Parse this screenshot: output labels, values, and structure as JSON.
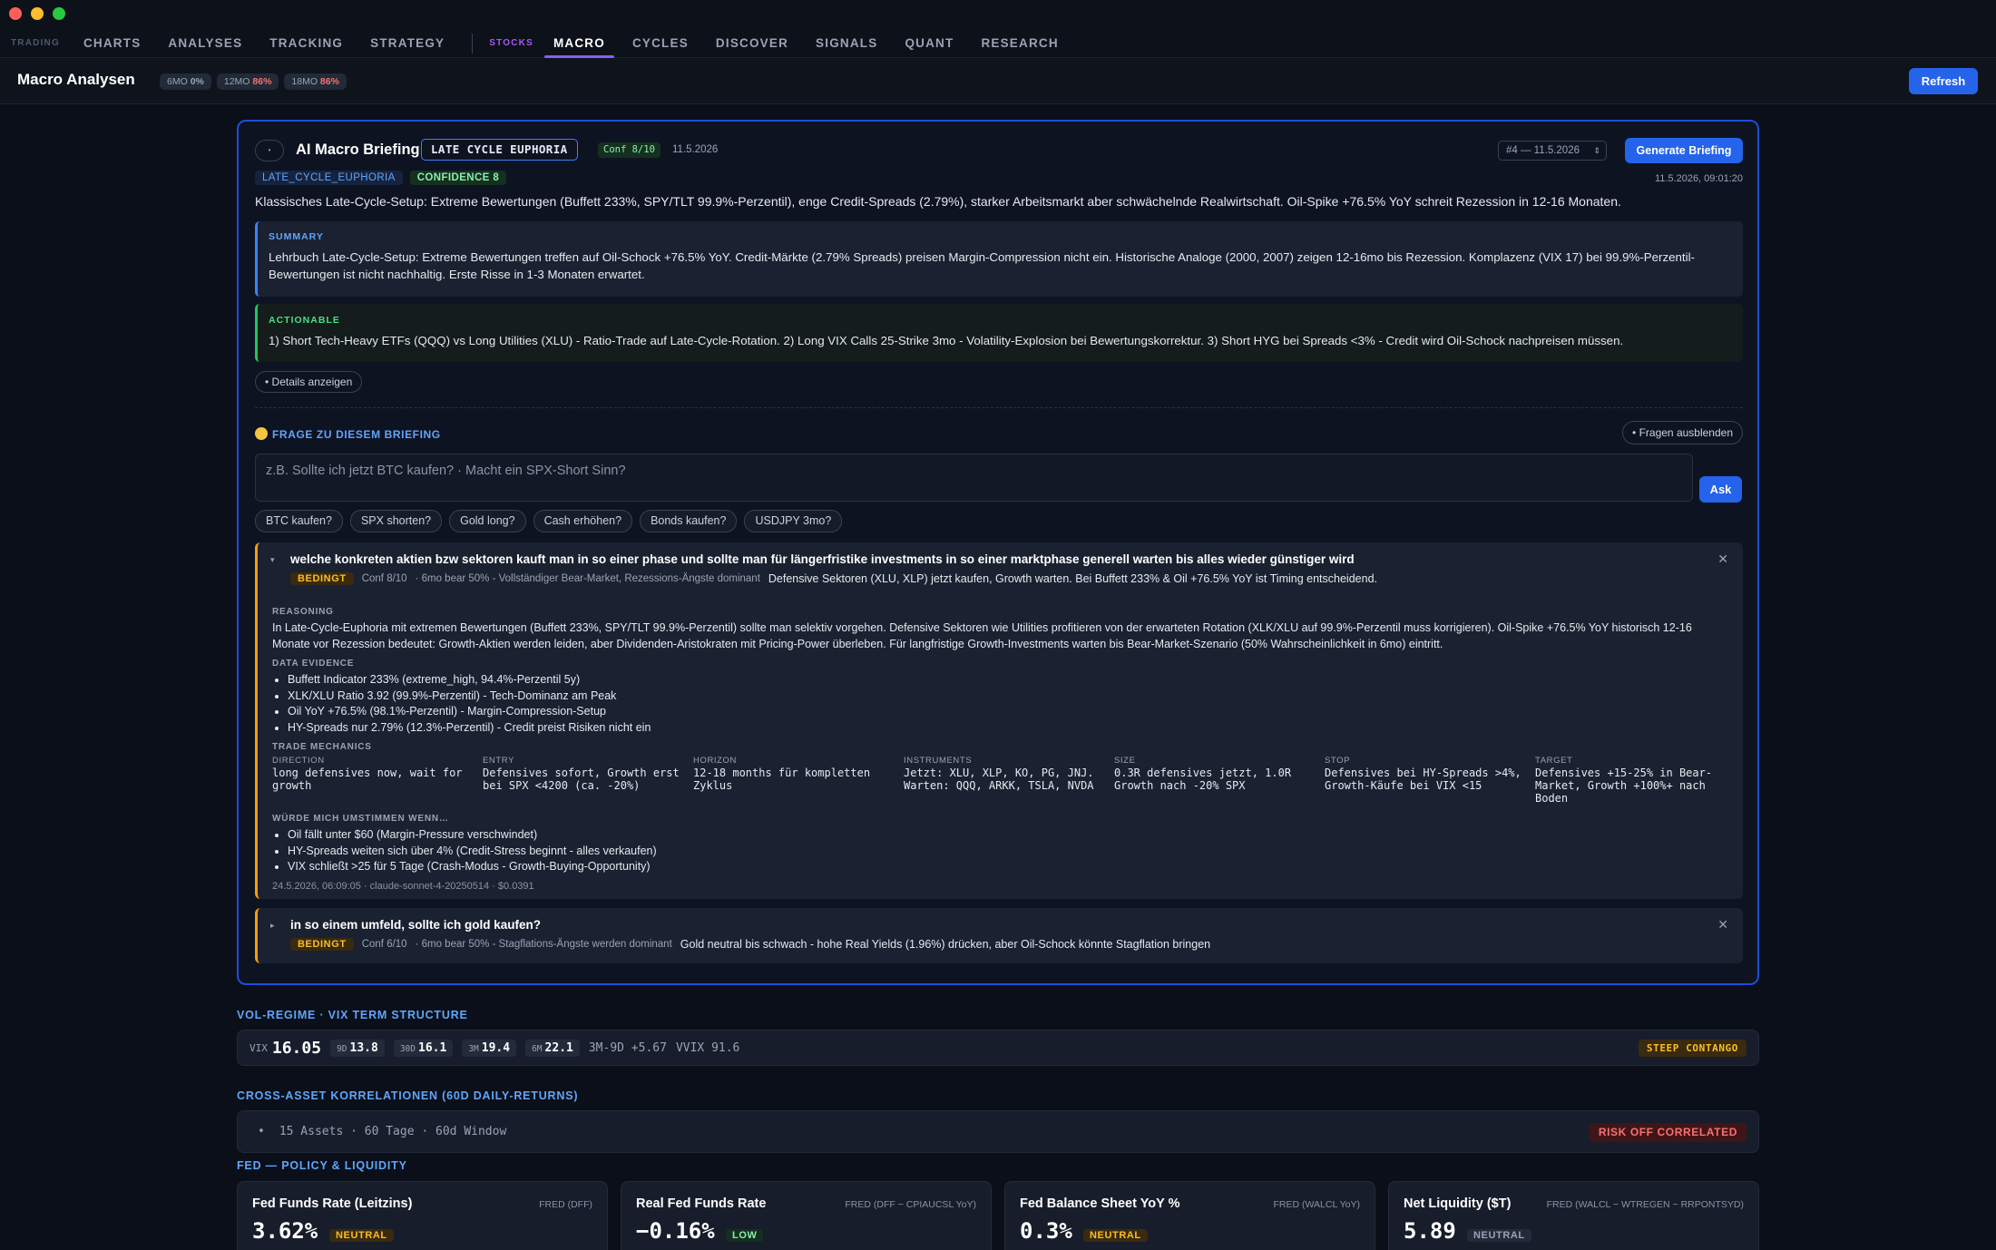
{
  "nav": {
    "trading_group": "TRADING",
    "trading_items": [
      "CHARTS",
      "ANALYSES",
      "TRACKING",
      "STRATEGY"
    ],
    "stocks_group": "STOCKS",
    "stocks_items": [
      "MACRO",
      "CYCLES",
      "DISCOVER",
      "SIGNALS",
      "QUANT",
      "RESEARCH"
    ],
    "active": "MACRO",
    "colors": {
      "trading": "#4b5874",
      "stocks": "#a855f7",
      "active_underline": "#8b5cf6"
    }
  },
  "header": {
    "title": "Macro Analysen",
    "badges": [
      {
        "label": "6MO",
        "value": "0%"
      },
      {
        "label": "12MO",
        "value": "86%"
      },
      {
        "label": "18MO",
        "value": "86%"
      }
    ],
    "refresh_label": "Refresh"
  },
  "briefing": {
    "toggle_icon": "•",
    "title": "AI Macro Briefing",
    "regime": "LATE CYCLE EUPHORIA",
    "conf": "Conf 8/10",
    "date": "11.5.2026",
    "select_value": "#4 — 11.5.2026",
    "generate_label": "Generate Briefing",
    "tag_regime": "LATE_CYCLE_EUPHORIA",
    "tag_conf": "CONFIDENCE 8",
    "timestamp": "11.5.2026, 09:01:20",
    "lead": "Klassisches Late-Cycle-Setup: Extreme Bewertungen (Buffett 233%, SPY/TLT 99.9%-Perzentil), enge Credit-Spreads (2.79%), starker Arbeitsmarkt aber schwächelnde Realwirtschaft. Oil-Spike +76.5% YoY schreit Rezession in 12-16 Monaten.",
    "summary_label": "SUMMARY",
    "summary": "Lehrbuch Late-Cycle-Setup: Extreme Bewertungen treffen auf Oil-Schock +76.5% YoY. Credit-Märkte (2.79% Spreads) preisen Margin-Compression nicht ein. Historische Analoge (2000, 2007) zeigen 12-16mo bis Rezession. Komplazenz (VIX 17) bei 99.9%-Perzentil-Bewertungen ist nicht nachhaltig. Erste Risse in 1-3 Monaten erwartet.",
    "actionable_label": "ACTIONABLE",
    "actionable": "1) Short Tech-Heavy ETFs (QQQ) vs Long Utilities (XLU) - Ratio-Trade auf Late-Cycle-Rotation. 2) Long VIX Calls 25-Strike 3mo - Volatility-Explosion bei Bewertungskorrektur. 3) Short HYG bei Spreads <3% - Credit wird Oil-Schock nachpreisen müssen.",
    "details_label": "• Details anzeigen"
  },
  "questions": {
    "title": "FRAGE ZU DIESEM BRIEFING",
    "hide_label": "• Fragen ausblenden",
    "placeholder": "z.B. Sollte ich jetzt BTC kaufen? · Macht ein SPX-Short Sinn?",
    "ask_label": "Ask",
    "chips": [
      "BTC kaufen?",
      "SPX shorten?",
      "Gold long?",
      "Cash erhöhen?",
      "Bonds kaufen?",
      "USDJPY 3mo?"
    ],
    "items": [
      {
        "question": "welche konkreten aktien bzw sektoren kauft man in so einer phase und sollte man für längerfristike investments in so einer marktphase generell warten bis alles wieder günstiger wird",
        "verdict": "BEDINGT",
        "conf": "Conf 8/10",
        "scenario": "· 6mo bear 50% - Vollständiger Bear-Market, Rezessions-Ängste dominant",
        "answer": "Defensive Sektoren (XLU, XLP) jetzt kaufen, Growth warten. Bei Buffett 233% & Oil +76.5% YoY ist Timing entscheidend.",
        "reasoning_label": "REASONING",
        "reasoning": "In Late-Cycle-Euphoria mit extremen Bewertungen (Buffett 233%, SPY/TLT 99.9%-Perzentil) sollte man selektiv vorgehen. Defensive Sektoren wie Utilities profitieren von der erwarteten Rotation (XLK/XLU auf 99.9%-Perzentil muss korrigieren). Oil-Spike +76.5% YoY historisch 12-16 Monate vor Rezession bedeutet: Growth-Aktien werden leiden, aber Dividenden-Aristokraten mit Pricing-Power überleben. Für langfristige Growth-Investments warten bis Bear-Market-Szenario (50% Wahrscheinlichkeit in 6mo) eintritt.",
        "evidence_label": "DATA EVIDENCE",
        "evidence": [
          "Buffett Indicator 233% (extreme_high, 94.4%-Perzentil 5y)",
          "XLK/XLU Ratio 3.92 (99.9%-Perzentil) - Tech-Dominanz am Peak",
          "Oil YoY +76.5% (98.1%-Perzentil) - Margin-Compression-Setup",
          "HY-Spreads nur 2.79% (12.3%-Perzentil) - Credit preist Risiken nicht ein"
        ],
        "mechanics_label": "TRADE MECHANICS",
        "mechanics": [
          {
            "key": "DIRECTION",
            "value": "long defensives now, wait for growth"
          },
          {
            "key": "ENTRY",
            "value": "Defensives sofort, Growth erst bei SPX <4200 (ca. -20%)"
          },
          {
            "key": "HORIZON",
            "value": "12-18 months für kompletten Zyklus"
          },
          {
            "key": "INSTRUMENTS",
            "value": "Jetzt: XLU, XLP, KO, PG, JNJ. Warten: QQQ, ARKK, TSLA, NVDA"
          },
          {
            "key": "SIZE",
            "value": "0.3R defensives jetzt, 1.0R Growth nach -20% SPX"
          },
          {
            "key": "STOP",
            "value": "Defensives bei HY-Spreads >4%, Growth-Käufe bei VIX <15"
          },
          {
            "key": "TARGET",
            "value": "Defensives +15-25% in Bear-Market, Growth +100%+ nach Boden"
          }
        ],
        "change_label": "WÜRDE MICH UMSTIMMEN WENN…",
        "change": [
          "Oil fällt unter $60 (Margin-Pressure verschwindet)",
          "HY-Spreads weiten sich über 4% (Credit-Stress beginnt - alles verkaufen)",
          "VIX schließt >25 für 5 Tage (Crash-Modus - Growth-Buying-Opportunity)"
        ],
        "footer": "24.5.2026, 06:09:05 · claude-sonnet-4-20250514 · $0.0391"
      },
      {
        "question": "in so einem umfeld, sollte ich gold kaufen?",
        "verdict": "BEDINGT",
        "conf": "Conf 6/10",
        "scenario": "· 6mo bear 50% - Stagflations-Ängste werden dominant",
        "answer": "Gold neutral bis schwach - hohe Real Yields (1.96%) drücken, aber Oil-Schock könnte Stagflation bringen"
      }
    ]
  },
  "vol": {
    "section_title": "VOL-REGIME · VIX TERM STRUCTURE",
    "vix_label": "VIX",
    "vix_value": "16.05",
    "terms": [
      {
        "label": "9D",
        "value": "13.8"
      },
      {
        "label": "30D",
        "value": "16.1"
      },
      {
        "label": "3M",
        "value": "19.4"
      },
      {
        "label": "6M",
        "value": "22.1"
      }
    ],
    "spread": "3M-9D +5.67",
    "vvix": "VVIX 91.6",
    "regime_badge": "STEEP CONTANGO"
  },
  "correlations": {
    "section_title": "CROSS-ASSET KORRELATIONEN (60D DAILY-RETURNS)",
    "toggle_icon": "•",
    "summary": "15 Assets · 60 Tage · 60d Window",
    "badge": "RISK OFF CORRELATED"
  },
  "fed": {
    "section_title": "FED — POLICY & LIQUIDITY",
    "cards": [
      {
        "title": "Fed Funds Rate (Leitzins)",
        "source": "FRED (DFF)",
        "value": "3.62%",
        "badge": "NEUTRAL"
      },
      {
        "title": "Real Fed Funds Rate",
        "source": "FRED (DFF − CPIAUCSL YoY)",
        "value": "−0.16%",
        "badge": "LOW"
      },
      {
        "title": "Fed Balance Sheet YoY %",
        "source": "FRED (WALCL YoY)",
        "value": "0.3%",
        "badge": "NEUTRAL"
      },
      {
        "title": "Net Liquidity ($T)",
        "source": "FRED (WALCL − WTREGEN − RRPONTSYD)",
        "value": "5.89",
        "badge": "NEUTRAL"
      }
    ]
  }
}
